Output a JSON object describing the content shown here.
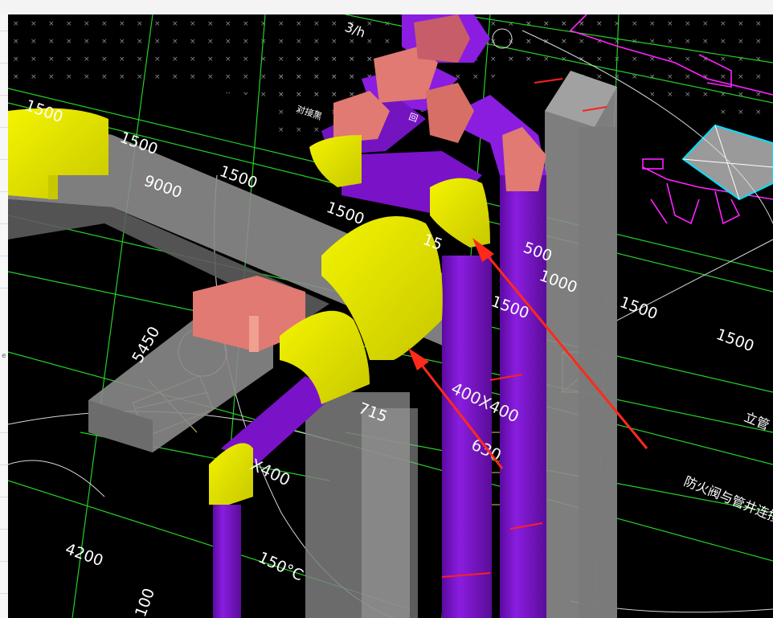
{
  "window": {
    "side_tool_glyph": "e"
  },
  "drawing": {
    "dimensions": {
      "d_1500_top_left": "1500",
      "d_1500_a": "1500",
      "d_1500_b": "1500",
      "d_1500_c": "1500",
      "d_9000": "9000",
      "d_15_trunc": "15",
      "d_500": "500",
      "d_1000": "1000",
      "d_1500_right_a": "1500",
      "d_1500_right_b": "1500",
      "d_1500_mid": "1500",
      "d_5450": "5450",
      "d_4200": "4200",
      "d_715": "715",
      "d_400x400": "400X400",
      "d_630": "630",
      "d_x400": "X400",
      "d_150c": "150°C",
      "d_100": "100"
    },
    "annotations": {
      "note_fire_damper": "防火阀与管井连接",
      "note_riser": "立管",
      "note_top_flow": "3/h",
      "note_small_a": "对接黑",
      "note_small_b": "回"
    },
    "colors": {
      "background": "#000000",
      "gray_duct": "#8c8c8c",
      "yellow_elbow": "#e6e600",
      "purple_duct": "#7a12c8",
      "salmon_transition": "#e07a72",
      "green_linework": "#25d025",
      "magenta_linework": "#ff22ff",
      "arrow_red": "#ff2a1a"
    },
    "icons": {
      "red_arrow_1": "annotation-arrow",
      "red_arrow_2": "annotation-arrow"
    }
  }
}
